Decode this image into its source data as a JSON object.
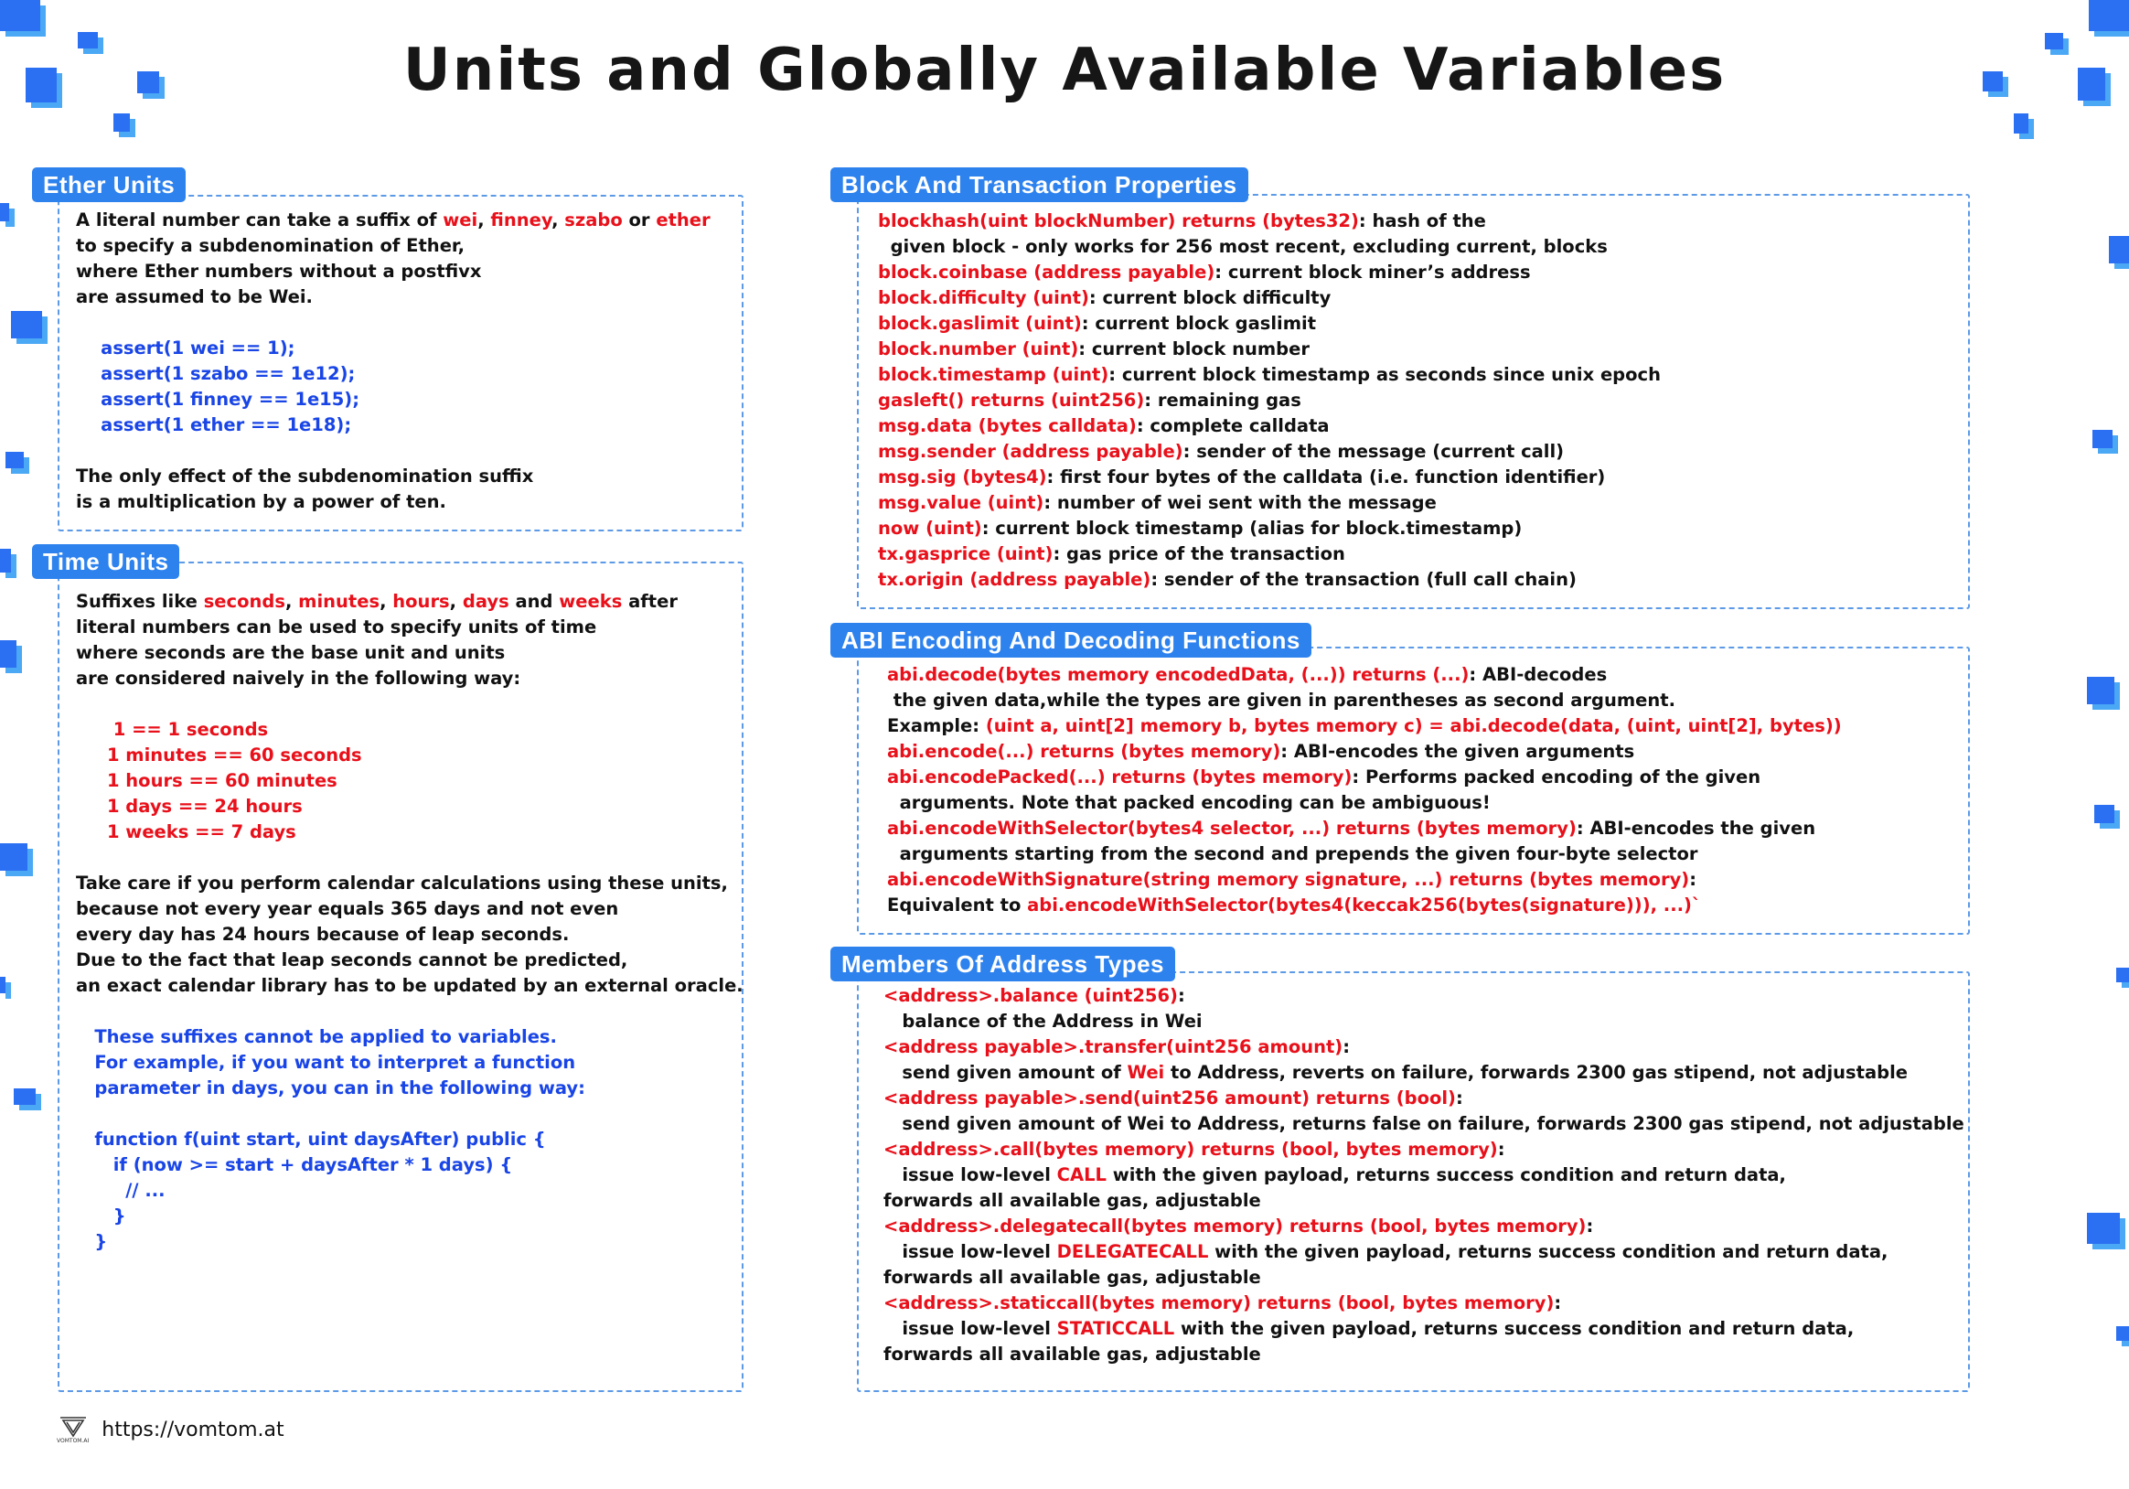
{
  "title": "Units and Globally Available Variables",
  "colors": {
    "accent_blue": "#2d82ee",
    "highlight_red": "#e8101a",
    "code_blue": "#1945e6",
    "dashed_border": "#5c9ae8"
  },
  "sections": {
    "ether_units": {
      "heading": "Ether Units",
      "lines": [
        [
          {
            "t": "A literal number can take a suffix of ",
            "c": "blk"
          },
          {
            "t": "wei",
            "c": "red"
          },
          {
            "t": ", ",
            "c": "blk"
          },
          {
            "t": "finney",
            "c": "red"
          },
          {
            "t": ", ",
            "c": "blk"
          },
          {
            "t": "szabo",
            "c": "red"
          },
          {
            "t": " or ",
            "c": "blk"
          },
          {
            "t": "ether",
            "c": "red"
          }
        ],
        [
          {
            "t": "to specify a subdenomination of Ether,",
            "c": "blk"
          }
        ],
        [
          {
            "t": "where Ether numbers without a postfivx",
            "c": "blk"
          }
        ],
        [
          {
            "t": "are assumed to be Wei.",
            "c": "blk"
          }
        ],
        [],
        [
          {
            "t": "    assert(1 wei == 1);",
            "c": "blue"
          }
        ],
        [
          {
            "t": "    assert(1 szabo == 1e12);",
            "c": "blue"
          }
        ],
        [
          {
            "t": "    assert(1 finney == 1e15);",
            "c": "blue"
          }
        ],
        [
          {
            "t": "    assert(1 ether == 1e18);",
            "c": "blue"
          }
        ],
        [],
        [
          {
            "t": "The only effect of the subdenomination suffix",
            "c": "blk"
          }
        ],
        [
          {
            "t": "is a multiplication by a power of ten.",
            "c": "blk"
          }
        ]
      ]
    },
    "time_units": {
      "heading": "Time Units",
      "lines": [
        [
          {
            "t": "Suffixes like ",
            "c": "blk"
          },
          {
            "t": "seconds",
            "c": "red"
          },
          {
            "t": ", ",
            "c": "blk"
          },
          {
            "t": "minutes",
            "c": "red"
          },
          {
            "t": ", ",
            "c": "blk"
          },
          {
            "t": "hours",
            "c": "red"
          },
          {
            "t": ", ",
            "c": "blk"
          },
          {
            "t": "days",
            "c": "red"
          },
          {
            "t": " and ",
            "c": "blk"
          },
          {
            "t": "weeks",
            "c": "red"
          },
          {
            "t": " after",
            "c": "blk"
          }
        ],
        [
          {
            "t": "literal numbers can be used to specify units of time",
            "c": "blk"
          }
        ],
        [
          {
            "t": "where seconds are the base unit and units",
            "c": "blk"
          }
        ],
        [
          {
            "t": "are considered naively in the following way:",
            "c": "blk"
          }
        ],
        [],
        [
          {
            "t": "      1 == 1 seconds",
            "c": "red"
          }
        ],
        [
          {
            "t": "     1 minutes == 60 seconds",
            "c": "red"
          }
        ],
        [
          {
            "t": "     1 hours == 60 minutes",
            "c": "red"
          }
        ],
        [
          {
            "t": "     1 days == 24 hours",
            "c": "red"
          }
        ],
        [
          {
            "t": "     1 weeks == 7 days",
            "c": "red"
          }
        ],
        [],
        [
          {
            "t": "Take care if you perform calendar calculations using these units,",
            "c": "blk"
          }
        ],
        [
          {
            "t": "because not every year equals 365 days and not even",
            "c": "blk"
          }
        ],
        [
          {
            "t": "every day has 24 hours because of leap seconds.",
            "c": "blk"
          }
        ],
        [
          {
            "t": "Due to the fact that leap seconds cannot be predicted,",
            "c": "blk"
          }
        ],
        [
          {
            "t": "an exact calendar library has to be updated by an external oracle.",
            "c": "blk"
          }
        ],
        [],
        [
          {
            "t": "   These suffixes cannot be applied to variables.",
            "c": "blue"
          }
        ],
        [
          {
            "t": "   For example, if you want to interpret a function",
            "c": "blue"
          }
        ],
        [
          {
            "t": "   parameter in days, you can in the following way:",
            "c": "blue"
          }
        ],
        [],
        [
          {
            "t": "   function f(uint start, uint daysAfter) public {",
            "c": "blue"
          }
        ],
        [
          {
            "t": "      if (now >= start + daysAfter * 1 days) {",
            "c": "blue"
          }
        ],
        [
          {
            "t": "        // ...",
            "c": "blue"
          }
        ],
        [
          {
            "t": "      }",
            "c": "blue"
          }
        ],
        [
          {
            "t": "   }",
            "c": "blue"
          }
        ]
      ]
    },
    "block_tx": {
      "heading": "Block And Transaction Properties",
      "lines": [
        [
          {
            "t": "blockhash(uint blockNumber) returns (bytes32)",
            "c": "red"
          },
          {
            "t": ": hash of the",
            "c": "blk"
          }
        ],
        [
          {
            "t": "  given block - only works for 256 most recent, excluding current, blocks",
            "c": "blk"
          }
        ],
        [
          {
            "t": "block.coinbase (address payable)",
            "c": "red"
          },
          {
            "t": ": current block miner’s address",
            "c": "blk"
          }
        ],
        [
          {
            "t": "block.difficulty (uint)",
            "c": "red"
          },
          {
            "t": ": current block difficulty",
            "c": "blk"
          }
        ],
        [
          {
            "t": "block.gaslimit (uint)",
            "c": "red"
          },
          {
            "t": ": current block gaslimit",
            "c": "blk"
          }
        ],
        [
          {
            "t": "block.number (uint)",
            "c": "red"
          },
          {
            "t": ": current block number",
            "c": "blk"
          }
        ],
        [
          {
            "t": "block.timestamp (uint)",
            "c": "red"
          },
          {
            "t": ": current block timestamp as seconds since unix epoch",
            "c": "blk"
          }
        ],
        [
          {
            "t": "gasleft() returns (uint256)",
            "c": "red"
          },
          {
            "t": ": remaining gas",
            "c": "blk"
          }
        ],
        [
          {
            "t": "msg.data (bytes calldata)",
            "c": "red"
          },
          {
            "t": ": complete calldata",
            "c": "blk"
          }
        ],
        [
          {
            "t": "msg.sender (address payable)",
            "c": "red"
          },
          {
            "t": ": sender of the message (current call)",
            "c": "blk"
          }
        ],
        [
          {
            "t": "msg.sig (bytes4)",
            "c": "red"
          },
          {
            "t": ": first four bytes of the calldata (i.e. function identifier)",
            "c": "blk"
          }
        ],
        [
          {
            "t": "msg.value (uint)",
            "c": "red"
          },
          {
            "t": ": number of wei sent with the message",
            "c": "blk"
          }
        ],
        [
          {
            "t": "now (uint)",
            "c": "red"
          },
          {
            "t": ": current block timestamp (alias for block.timestamp)",
            "c": "blk"
          }
        ],
        [
          {
            "t": "tx.gasprice (uint)",
            "c": "red"
          },
          {
            "t": ": gas price of the transaction",
            "c": "blk"
          }
        ],
        [
          {
            "t": "tx.origin (address payable)",
            "c": "red"
          },
          {
            "t": ": sender of the transaction (full call chain)",
            "c": "blk"
          }
        ]
      ]
    },
    "abi": {
      "heading": "ABI Encoding And Decoding Functions",
      "lines": [
        [
          {
            "t": "abi.decode(bytes memory encodedData, (...)) returns (...)",
            "c": "red"
          },
          {
            "t": ": ABI-decodes",
            "c": "blk"
          }
        ],
        [
          {
            "t": " the given data,while the types are given in parentheses as second argument.",
            "c": "blk"
          }
        ],
        [
          {
            "t": "Example: ",
            "c": "blk"
          },
          {
            "t": "(uint a, uint[2] memory b, bytes memory c) = abi.decode(data, (uint, uint[2], bytes))",
            "c": "red"
          }
        ],
        [
          {
            "t": "abi.encode(...) returns (bytes memory)",
            "c": "red"
          },
          {
            "t": ": ABI-encodes the given arguments",
            "c": "blk"
          }
        ],
        [
          {
            "t": "abi.encodePacked(...) returns (bytes memory)",
            "c": "red"
          },
          {
            "t": ": Performs packed encoding of the given",
            "c": "blk"
          }
        ],
        [
          {
            "t": "  arguments. Note that packed encoding can be ambiguous!",
            "c": "blk"
          }
        ],
        [
          {
            "t": "abi.encodeWithSelector(bytes4 selector, ...) returns (bytes memory)",
            "c": "red"
          },
          {
            "t": ": ABI-encodes the given",
            "c": "blk"
          }
        ],
        [
          {
            "t": "  arguments starting from the second and prepends the given four-byte selector",
            "c": "blk"
          }
        ],
        [
          {
            "t": "abi.encodeWithSignature(string memory signature, ...) returns (bytes memory)",
            "c": "red"
          },
          {
            "t": ":",
            "c": "blk"
          }
        ],
        [
          {
            "t": "Equivalent to ",
            "c": "blk"
          },
          {
            "t": "abi.encodeWithSelector(bytes4(keccak256(bytes(signature))), ...)`",
            "c": "red"
          }
        ]
      ]
    },
    "address_members": {
      "heading": "Members Of Address Types",
      "lines": [
        [
          {
            "t": "<address>.balance (uint256)",
            "c": "red"
          },
          {
            "t": ":",
            "c": "blk"
          }
        ],
        [
          {
            "t": "   balance of the Address in Wei",
            "c": "blk"
          }
        ],
        [
          {
            "t": "<address payable>.transfer(uint256 amount)",
            "c": "red"
          },
          {
            "t": ":",
            "c": "blk"
          }
        ],
        [
          {
            "t": "   send given amount of ",
            "c": "blk"
          },
          {
            "t": "Wei",
            "c": "red"
          },
          {
            "t": " to Address, reverts on failure, forwards 2300 gas stipend, not adjustable",
            "c": "blk"
          }
        ],
        [
          {
            "t": "<address payable>.send(uint256 amount) returns (bool)",
            "c": "red"
          },
          {
            "t": ":",
            "c": "blk"
          }
        ],
        [
          {
            "t": "   send given amount of Wei to Address, returns false on failure, forwards 2300 gas stipend, not adjustable",
            "c": "blk"
          }
        ],
        [
          {
            "t": "<address>.call(bytes memory) returns (bool, bytes memory)",
            "c": "red"
          },
          {
            "t": ":",
            "c": "blk"
          }
        ],
        [
          {
            "t": "   issue low-level ",
            "c": "blk"
          },
          {
            "t": "CALL",
            "c": "red"
          },
          {
            "t": " with the given payload, returns success condition and return data,",
            "c": "blk"
          }
        ],
        [
          {
            "t": "forwards all available gas, adjustable",
            "c": "blk"
          }
        ],
        [
          {
            "t": "<address>.delegatecall(bytes memory) returns (bool, bytes memory)",
            "c": "red"
          },
          {
            "t": ":",
            "c": "blk"
          }
        ],
        [
          {
            "t": "   issue low-level ",
            "c": "blk"
          },
          {
            "t": "DELEGATECALL",
            "c": "red"
          },
          {
            "t": " with the given payload, returns success condition and return data,",
            "c": "blk"
          }
        ],
        [
          {
            "t": "forwards all available gas, adjustable",
            "c": "blk"
          }
        ],
        [
          {
            "t": "<address>.staticcall(bytes memory) returns (bool, bytes memory)",
            "c": "red"
          },
          {
            "t": ":",
            "c": "blk"
          }
        ],
        [
          {
            "t": "   issue low-level ",
            "c": "blk"
          },
          {
            "t": "STATICCALL",
            "c": "red"
          },
          {
            "t": " with the given payload, returns success condition and return data,",
            "c": "blk"
          }
        ],
        [
          {
            "t": "forwards all available gas, adjustable",
            "c": "blk"
          }
        ]
      ]
    }
  },
  "footer": {
    "logo_icon": "vomtom-logo-icon",
    "logo_caption": "VOMTOM.AI",
    "url": "https://vomtom.at"
  }
}
